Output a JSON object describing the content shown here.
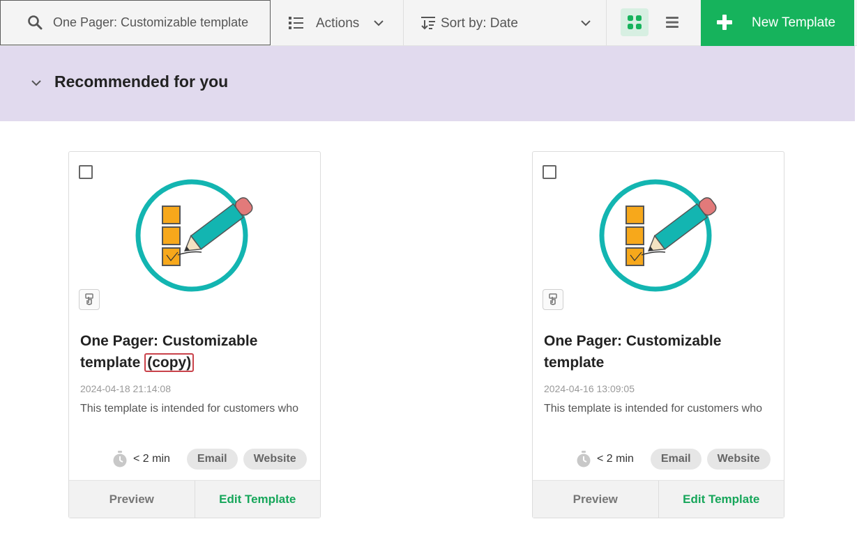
{
  "toolbar": {
    "search_value": "One Pager: Customizable template",
    "actions_label": "Actions",
    "sort_label": "Sort by: Date",
    "new_template_label": "New Template"
  },
  "section": {
    "title": "Recommended for you"
  },
  "cards": [
    {
      "title_main": "One Pager: Customizable template",
      "title_suffix": "(copy)",
      "date": "2024-04-18 21:14:08",
      "description": "This template is intended for customers who",
      "duration": "< 2 min",
      "tags": [
        "Email",
        "Website"
      ],
      "preview_label": "Preview",
      "edit_label": "Edit Template"
    },
    {
      "title_main": "One Pager: Customizable template",
      "title_suffix": "",
      "date": "2024-04-16 13:09:05",
      "description": "This template is intended for customers who",
      "duration": "< 2 min",
      "tags": [
        "Email",
        "Website"
      ],
      "preview_label": "Preview",
      "edit_label": "Edit Template"
    }
  ],
  "colors": {
    "brand_green": "#16b35c",
    "band_purple": "#e1daee",
    "highlight_red": "#c9424a",
    "teal": "#13b5b1",
    "orange": "#f7a81b"
  }
}
